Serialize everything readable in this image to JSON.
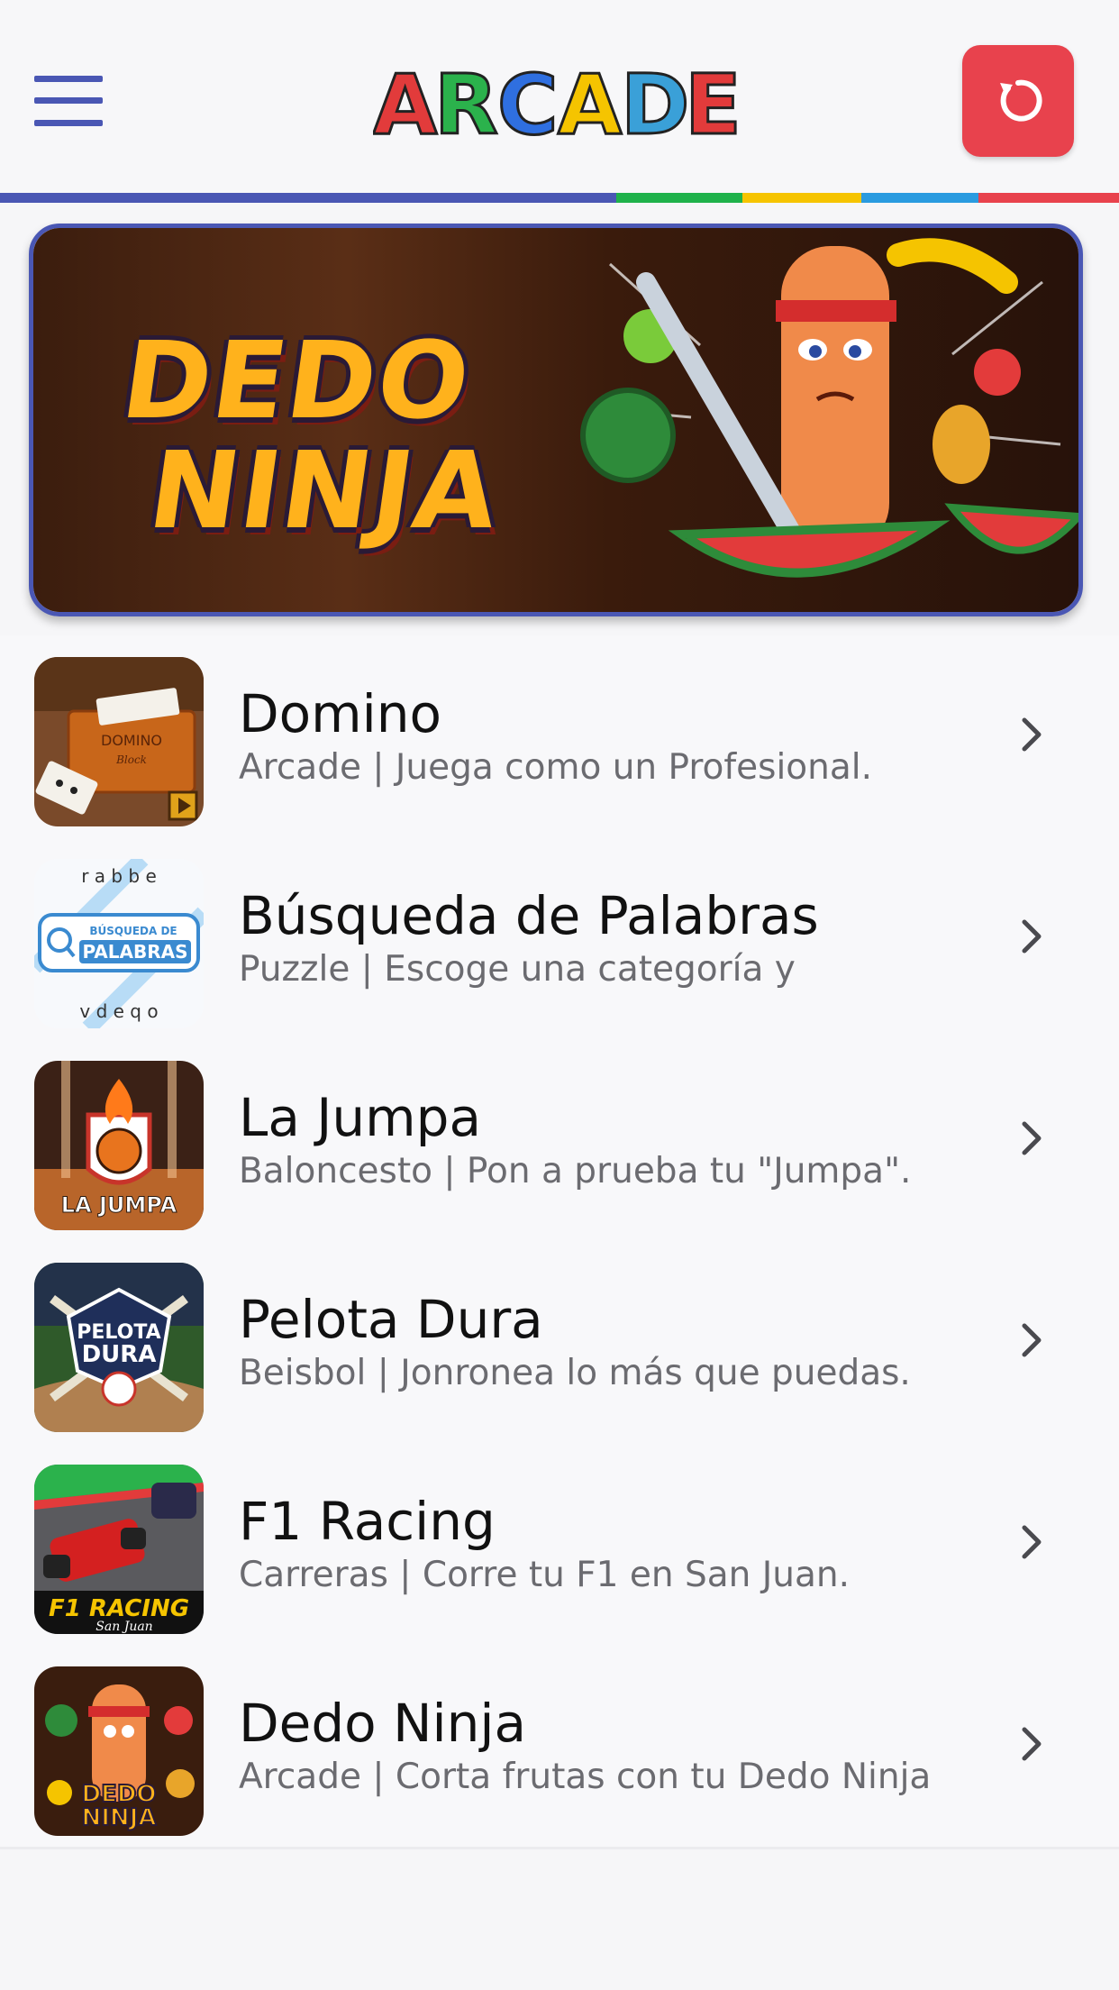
{
  "header": {
    "logo_text": "ARCADE",
    "logo_letter_colors": [
      "#e23b3b",
      "#2bb24c",
      "#2f6fe0",
      "#f5c400",
      "#3aa0d8",
      "#e23b3b"
    ]
  },
  "stripe_colors": [
    "#4a57b4",
    "#1fb24b",
    "#f6c400",
    "#2a9be0",
    "#e8424d"
  ],
  "banner": {
    "line1": "DEDO",
    "line2": "NINJA"
  },
  "games": [
    {
      "title": "Domino",
      "subtitle": "Arcade | Juega como un Profesional.",
      "thumb_icon": "domino-thumb-icon"
    },
    {
      "title": "Búsqueda de Palabras",
      "subtitle": "Puzzle | Escoge una categoría y",
      "thumb_icon": "word-search-thumb-icon"
    },
    {
      "title": "La Jumpa",
      "subtitle": "Baloncesto | Pon a prueba tu \"Jumpa\".",
      "thumb_icon": "basketball-thumb-icon"
    },
    {
      "title": "Pelota Dura",
      "subtitle": "Beisbol | Jonronea lo más que puedas.",
      "thumb_icon": "baseball-thumb-icon"
    },
    {
      "title": "F1 Racing",
      "subtitle": "Carreras | Corre tu F1 en San Juan.",
      "thumb_icon": "f1-racing-thumb-icon"
    },
    {
      "title": "Dedo Ninja",
      "subtitle": "Arcade | Corta frutas con tu Dedo Ninja",
      "thumb_icon": "dedo-ninja-thumb-icon"
    }
  ],
  "thumb_text": {
    "domino": "DOMINO",
    "domino_sub": "Block",
    "ws1": "BÚSQUEDA DE",
    "ws2": "PALABRAS",
    "ws_letters_top": "r a b b e",
    "ws_letters_bottom": "v d e q o",
    "jumpa": "LA JUMPA",
    "pelota1": "PELOTA",
    "pelota2": "DURA",
    "f1": "F1 RACING",
    "f1_sub": "San Juan",
    "ninja1": "DEDO",
    "ninja2": "NINJA"
  }
}
